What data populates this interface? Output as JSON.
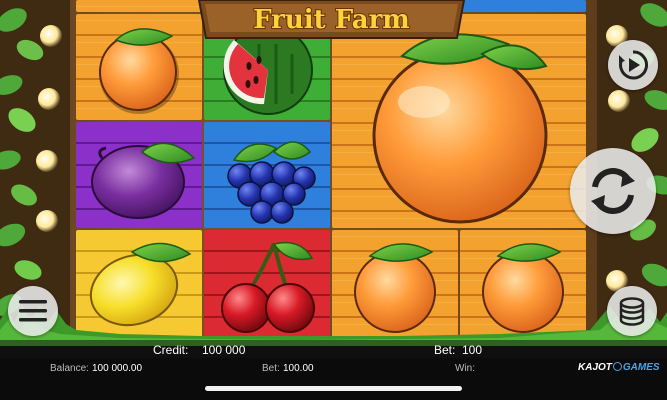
{
  "game": {
    "title": "Fruit Farm"
  },
  "reels": [
    {
      "column": 1,
      "symbols": [
        "orange",
        "plum",
        "lemon"
      ]
    },
    {
      "column": 2,
      "symbols": [
        "watermelon",
        "grapes",
        "cherries"
      ]
    },
    {
      "column": 3,
      "symbols": [
        "giant-orange",
        "orange"
      ]
    },
    {
      "column": 4,
      "symbols": [
        "orange"
      ]
    }
  ],
  "status_bar": {
    "credit_label": "Credit:",
    "credit_value": "100 000",
    "bet_label": "Bet:",
    "bet_value": "100"
  },
  "info_bar": {
    "balance_label": "Balance:",
    "balance_value": "100 000.00",
    "bet_label": "Bet:",
    "bet_value": "100.00",
    "win_label": "Win:",
    "win_value": "",
    "brand_main": "KAJOT",
    "brand_sub": "GAMES"
  },
  "controls": {
    "autoplay_icon": "play-icon",
    "spin_icon": "refresh-icon",
    "menu_icon": "hamburger-icon",
    "bet_icon": "coin-stack-icon"
  },
  "colors": {
    "orange_tile": "#f5a02e",
    "purple_tile": "#8a2ec8",
    "green_tile": "#3aa832",
    "blue_tile": "#2a78d8",
    "red_tile": "#d8242e",
    "yellow_tile": "#f4c42e"
  }
}
